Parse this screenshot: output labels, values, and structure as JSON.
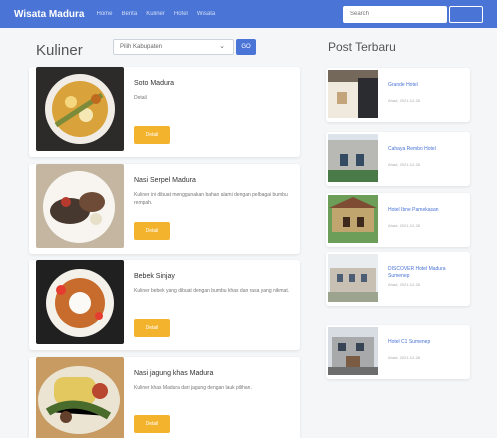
{
  "nav": {
    "brand": "Wisata Madura",
    "links": [
      "Home",
      "Berita",
      "Kuliner",
      "Hotel",
      "Wisata"
    ],
    "search_placeholder": "Search",
    "search_button_label": ""
  },
  "page": {
    "title": "Kuliner",
    "filter_value": "Pilih Kabupaten",
    "filter_button_label": "GO"
  },
  "kuliner": [
    {
      "title": "Soto Madura",
      "description": "Detail",
      "button": "Detail"
    },
    {
      "title": "Nasi Serpel Madura",
      "description": "Kuliner ini dibuat menggunakan bahan alami dengan pelbagai bumbu rempah.",
      "button": "Detail"
    },
    {
      "title": "Bebek Sinjay",
      "description": "Kuliner bebek yang dibuat dengan bumbu khas dan rasa yang nikmat.",
      "button": "Detail"
    },
    {
      "title": "Nasi jagung khas Madura",
      "description": "Kuliner khas Madura dari jagung dengan lauk pilihan.",
      "button": "Detail"
    }
  ],
  "posts": {
    "title": "Post Terbaru",
    "items": [
      {
        "title": "Grande Hotel",
        "date": "Ahad, 2021-12-28"
      },
      {
        "title": "Cahaya Rembo Hotel",
        "date": "Ahad, 2021-12-28"
      },
      {
        "title": "Hotel Ibne Pamekasan",
        "date": "Ahad, 2021-12-28"
      },
      {
        "title": "DISCOVER Hotel Madura Sumenep",
        "date": "Ahad, 2021-12-28"
      },
      {
        "title": "Hotel C1 Sumenep",
        "date": "Ahad, 2021-12-28"
      }
    ]
  },
  "colors": {
    "nav": "#4a74d6",
    "button": "#f3b32d",
    "link": "#4a74d6"
  },
  "icons": {
    "filter_dropdown": "chevron-down-icon"
  }
}
